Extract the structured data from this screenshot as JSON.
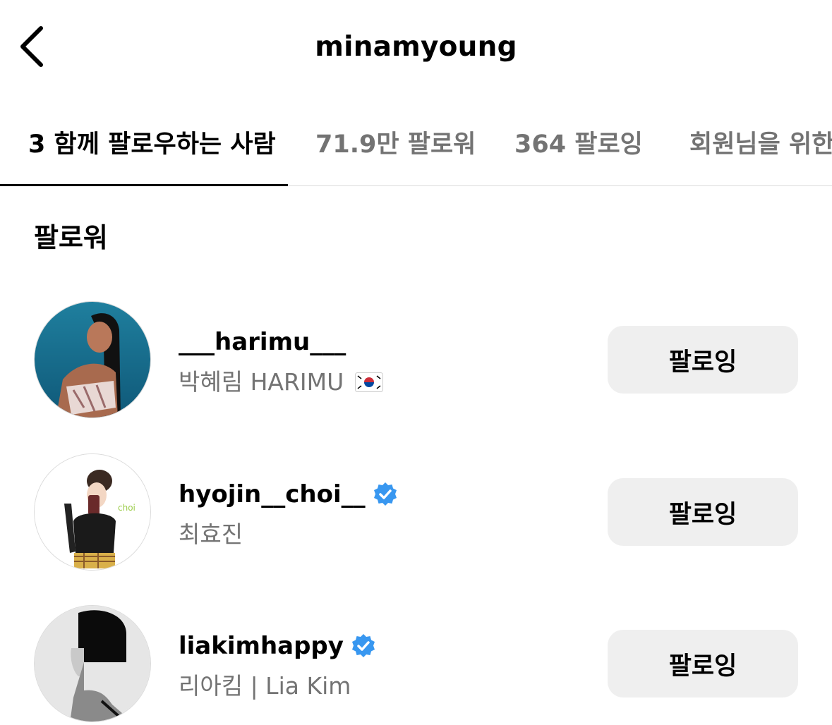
{
  "header": {
    "title": "minamyoung"
  },
  "tabs": [
    {
      "label": "3 함께 팔로우하는 사람",
      "active": true
    },
    {
      "label": "71.9만 팔로워",
      "active": false
    },
    {
      "label": "364 팔로잉",
      "active": false
    },
    {
      "label": "회원님을 위한",
      "active": false
    }
  ],
  "section": {
    "title": "팔로워"
  },
  "users": [
    {
      "username": "___harimu___",
      "full_name": "박혜림 HARIMU",
      "verified": false,
      "flag_icon": "south-korea-flag-icon",
      "button_label": "팔로잉"
    },
    {
      "username": "hyojin__choi__",
      "full_name": "최효진",
      "verified": true,
      "button_label": "팔로잉"
    },
    {
      "username": "liakimhappy",
      "full_name": "리아킴 | Lia Kim",
      "verified": true,
      "button_label": "팔로잉"
    }
  ],
  "colors": {
    "verified_blue": "#3897f0",
    "secondary_text": "#737373",
    "button_bg": "#efefef",
    "divider": "#dbdbdb"
  }
}
